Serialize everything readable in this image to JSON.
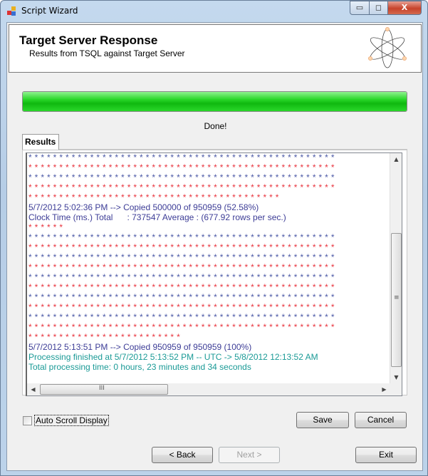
{
  "window": {
    "title": "Script Wizard",
    "minimize": "▭",
    "maximize": "◻",
    "close": "X"
  },
  "header": {
    "title": "Target Server Response",
    "subtitle": "Results from TSQL against Target Server",
    "logo_icon": "atom-icon"
  },
  "progress": {
    "percent": 100,
    "color": "#1ec81e"
  },
  "status_text": "Done!",
  "tabs": [
    {
      "label": "Results",
      "active": true
    }
  ],
  "colors": {
    "blue": "#4a58a6",
    "red": "#e8323c",
    "purple": "#3c3c96",
    "teal": "#1a9a96"
  },
  "results_lines": [
    {
      "text": "**************************************************",
      "color": "blue",
      "stars": true
    },
    {
      "text": "**************************************************",
      "color": "red",
      "stars": true
    },
    {
      "text": "**************************************************",
      "color": "blue",
      "stars": true
    },
    {
      "text": "**************************************************",
      "color": "red",
      "stars": true
    },
    {
      "text": "*****************************************",
      "color": "red",
      "stars": true
    },
    {
      "text": "5/7/2012 5:02:36 PM --> Copied 500000 of 950959 (52.58%)",
      "color": "purple"
    },
    {
      "text": "Clock Time (ms.) Total      : 737547 Average : (677.92 rows per sec.)",
      "color": "purple"
    },
    {
      "text": "******",
      "color": "red",
      "stars": true
    },
    {
      "text": "**************************************************",
      "color": "blue",
      "stars": true
    },
    {
      "text": "**************************************************",
      "color": "red",
      "stars": true
    },
    {
      "text": "**************************************************",
      "color": "blue",
      "stars": true
    },
    {
      "text": "**************************************************",
      "color": "red",
      "stars": true
    },
    {
      "text": "**************************************************",
      "color": "blue",
      "stars": true
    },
    {
      "text": "**************************************************",
      "color": "red",
      "stars": true
    },
    {
      "text": "**************************************************",
      "color": "blue",
      "stars": true
    },
    {
      "text": "**************************************************",
      "color": "red",
      "stars": true
    },
    {
      "text": "**************************************************",
      "color": "blue",
      "stars": true
    },
    {
      "text": "**************************************************",
      "color": "red",
      "stars": true
    },
    {
      "text": "*************************",
      "color": "red",
      "stars": true
    },
    {
      "text": "5/7/2012 5:13:51 PM --> Copied 950959 of 950959 (100%)",
      "color": "purple"
    },
    {
      "text": "Processing finished at 5/7/2012 5:13:52 PM -- UTC -> 5/8/2012 12:13:52 AM",
      "color": "teal"
    },
    {
      "text": "Total processing time: 0 hours, 23 minutes and 34 seconds",
      "color": "teal"
    }
  ],
  "scroll": {
    "up": "▲",
    "down": "▼",
    "left": "◀",
    "right": "▶",
    "grip_v": "≡",
    "grip_h": "III"
  },
  "auto_scroll": {
    "label": "Auto Scroll Display",
    "checked": false
  },
  "buttons": {
    "save": "Save",
    "cancel": "Cancel",
    "back": "< Back",
    "next": "Next >",
    "exit": "Exit"
  }
}
